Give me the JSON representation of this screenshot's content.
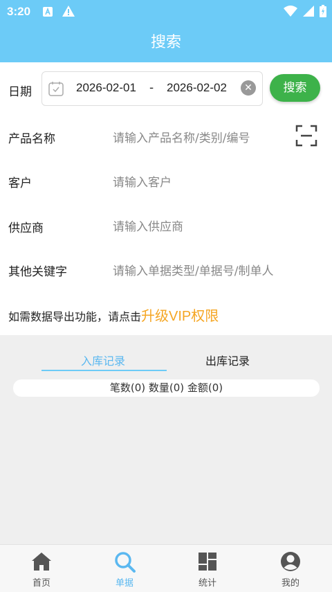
{
  "status_bar": {
    "time": "3:20"
  },
  "header": {
    "title": "搜索"
  },
  "date": {
    "label": "日期",
    "start": "2026-02-01",
    "separator": "-",
    "end": "2026-02-02"
  },
  "search_button": "搜索",
  "fields": {
    "product": {
      "label": "产品名称",
      "placeholder": "请输入产品名称/类别/编号"
    },
    "customer": {
      "label": "客户",
      "placeholder": "请输入客户"
    },
    "supplier": {
      "label": "供应商",
      "placeholder": "请输入供应商"
    },
    "keyword": {
      "label": "其他关键字",
      "placeholder": "请输入单据类型/单据号/制单人"
    }
  },
  "vip": {
    "prefix": "如需数据导出功能，请点击",
    "link": "升级VIP权限"
  },
  "tabs": [
    {
      "label": "入库记录",
      "active": true
    },
    {
      "label": "出库记录",
      "active": false
    }
  ],
  "summary": "笔数(0) 数量(0) 金额(0)",
  "bottom_nav": [
    {
      "label": "首页",
      "icon": "home-icon"
    },
    {
      "label": "单据",
      "icon": "search-icon",
      "active": true
    },
    {
      "label": "统计",
      "icon": "stats-icon"
    },
    {
      "label": "我的",
      "icon": "profile-icon"
    }
  ],
  "colors": {
    "primary": "#6ccbf7",
    "green": "#3db24a",
    "vip": "#f5a623",
    "active_tab": "#5bb8f0"
  }
}
